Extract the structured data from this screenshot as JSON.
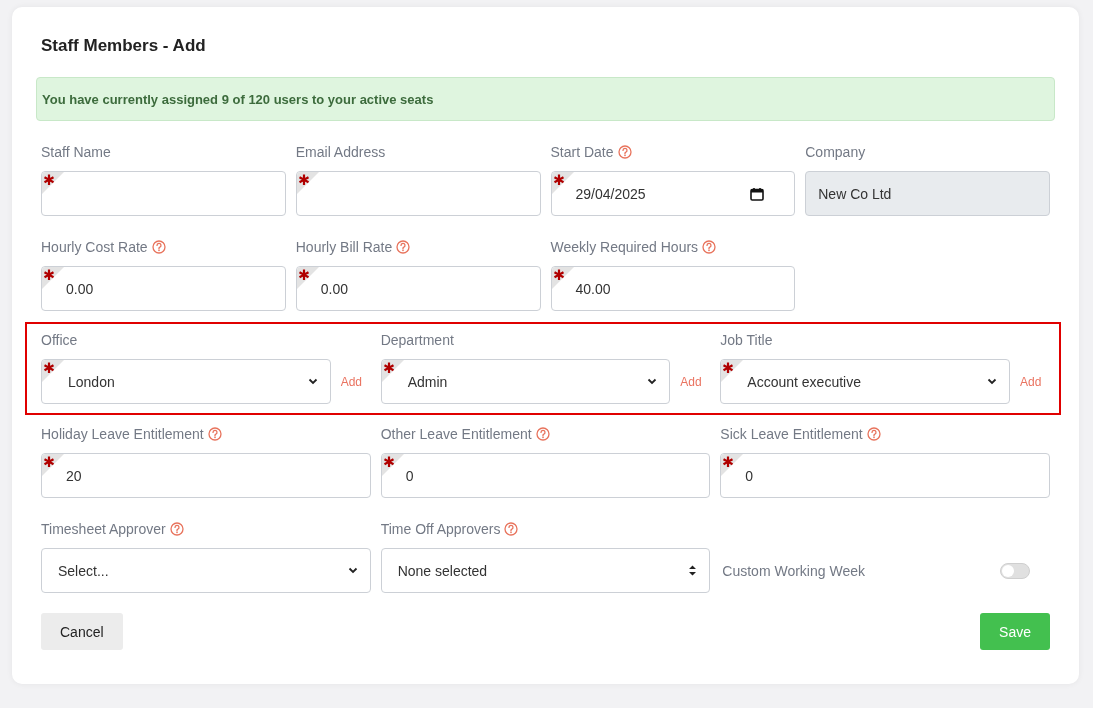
{
  "title": "Staff Members - Add",
  "alert": "You have currently assigned 9 of 120 users to your active seats",
  "rows": [
    {
      "highlighted": false,
      "fields": [
        {
          "kind": "text",
          "label": "Staff Name",
          "help": false,
          "required": true
        },
        {
          "kind": "text",
          "label": "Email Address",
          "help": false,
          "required": true
        },
        {
          "kind": "date",
          "label": "Start Date",
          "help": true,
          "required": true,
          "value": "29/04/2025"
        },
        {
          "kind": "readonly",
          "label": "Company",
          "help": false,
          "required": false,
          "value": "New Co Ltd"
        }
      ]
    },
    {
      "highlighted": false,
      "fields": [
        {
          "kind": "text",
          "label": "Hourly Cost Rate",
          "help": true,
          "required": true,
          "value": "0.00"
        },
        {
          "kind": "text",
          "label": "Hourly Bill Rate",
          "help": true,
          "required": true,
          "value": "0.00"
        },
        {
          "kind": "text",
          "label": "Weekly Required Hours",
          "help": true,
          "required": true,
          "value": "40.00"
        }
      ]
    },
    {
      "highlighted": true,
      "fields": [
        {
          "kind": "select",
          "label": "Office",
          "help": false,
          "required": true,
          "value": "London",
          "add_link": "Add"
        },
        {
          "kind": "select",
          "label": "Department",
          "help": false,
          "required": true,
          "value": "Admin",
          "add_link": "Add"
        },
        {
          "kind": "select",
          "label": "Job Title",
          "help": false,
          "required": true,
          "value": "Account executive",
          "add_link": "Add"
        }
      ]
    },
    {
      "highlighted": false,
      "fields": [
        {
          "kind": "text",
          "label": "Holiday Leave Entitlement",
          "help": true,
          "required": true,
          "value": "20"
        },
        {
          "kind": "text",
          "label": "Other Leave Entitlement",
          "help": true,
          "required": true,
          "value": "0"
        },
        {
          "kind": "text",
          "label": "Sick Leave Entitlement",
          "help": true,
          "required": true,
          "value": "0"
        }
      ]
    },
    {
      "highlighted": false,
      "fields": [
        {
          "kind": "select",
          "label": "Timesheet Approver",
          "help": true,
          "required": false,
          "value": "Select..."
        },
        {
          "kind": "multiselect",
          "label": "Time Off Approvers",
          "help": true,
          "required": false,
          "value": "None selected"
        },
        {
          "kind": "toggle",
          "label": "Custom Working Week",
          "on": false
        }
      ]
    }
  ],
  "buttons": [
    {
      "kind": "secondary",
      "label": "Cancel"
    },
    {
      "kind": "primary",
      "label": "Save"
    }
  ]
}
